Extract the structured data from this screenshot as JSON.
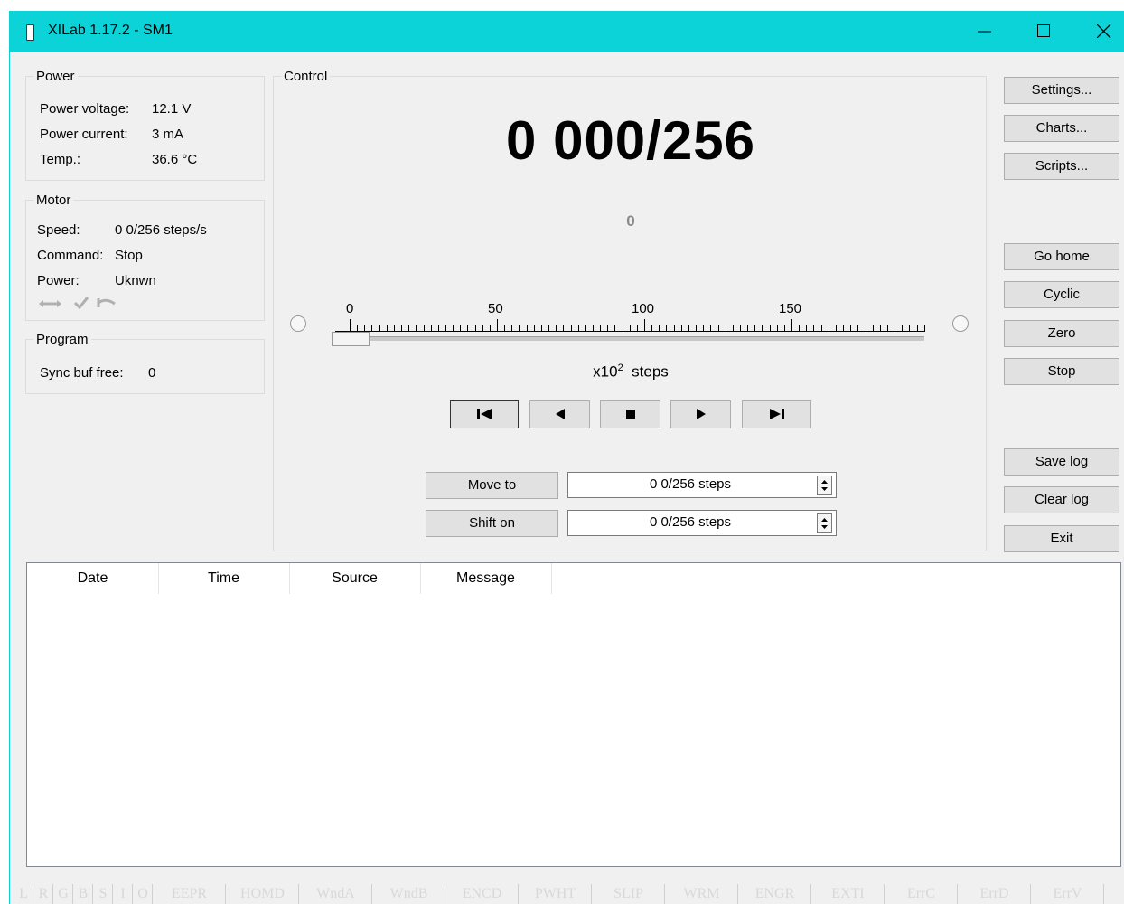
{
  "window": {
    "title": "XILab 1.17.2 - SM1"
  },
  "power": {
    "group_label": "Power",
    "voltage_label": "Power voltage:",
    "voltage_value": "12.1 V",
    "current_label": "Power current:",
    "current_value": "3 mA",
    "temp_label": "Temp.:",
    "temp_value": "36.6 °C"
  },
  "motor": {
    "group_label": "Motor",
    "speed_label": "Speed:",
    "speed_value": "0 0/256 steps/s",
    "command_label": "Command:",
    "command_value": "Stop",
    "power_label": "Power:",
    "power_value": "Uknwn"
  },
  "program": {
    "group_label": "Program",
    "syncbuf_label": "Sync buf free:",
    "syncbuf_value": "0"
  },
  "control": {
    "group_label": "Control",
    "position": "0 000/256",
    "encoder": "0",
    "slider_ticks": [
      "0",
      "50",
      "100",
      "150"
    ],
    "slider_fraction": 0.0,
    "units_base": "x10",
    "units_exp": "2",
    "units_label": "steps",
    "move_to_label": "Move to",
    "move_to_value": "0 0/256 steps",
    "shift_on_label": "Shift on",
    "shift_on_value": "0 0/256 steps"
  },
  "right_buttons": {
    "settings": "Settings...",
    "charts": "Charts...",
    "scripts": "Scripts...",
    "go_home": "Go home",
    "cyclic": "Cyclic",
    "zero": "Zero",
    "stop": "Stop",
    "save_log": "Save log",
    "clear_log": "Clear log",
    "exit": "Exit"
  },
  "log": {
    "columns": [
      "Date",
      "Time",
      "Source",
      "Message"
    ]
  },
  "status_flags": [
    "L",
    "R",
    "G",
    "B",
    "S",
    "I",
    "O",
    "EEPR",
    "HOMD",
    "WndA",
    "WndB",
    "ENCD",
    "PWHT",
    "SLIP",
    "WRM",
    "ENGR",
    "EXTI",
    "ErrC",
    "ErrD",
    "ErrV"
  ],
  "colors": {
    "titlebar": "#0cd3d8",
    "panel": "#f0f0f0",
    "button": "#e1e1e1"
  }
}
